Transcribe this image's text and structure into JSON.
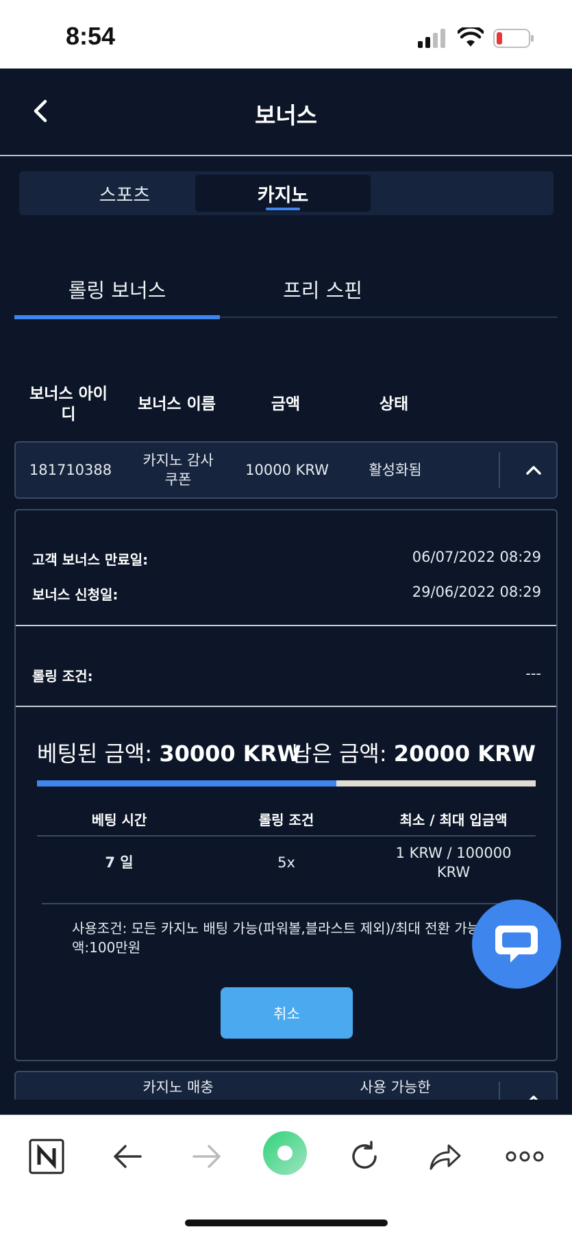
{
  "status_bar": {
    "time": "8:54"
  },
  "header": {
    "title": "보너스"
  },
  "segments": [
    {
      "label": "스포츠",
      "active": false
    },
    {
      "label": "카지노",
      "active": true
    }
  ],
  "subtabs": [
    {
      "label": "롤링 보너스",
      "active": true
    },
    {
      "label": "프리 스핀",
      "active": false
    }
  ],
  "table": {
    "headers": [
      "보너스 아이\n디",
      "보너스 이름",
      "금액",
      "상태"
    ],
    "rows": [
      {
        "id": "181710388",
        "name": "카지노 감사\n쿠폰",
        "amount": "10000 KRW",
        "status": "활성화됨"
      },
      {
        "id": "",
        "name": "카지노 매충",
        "amount": "",
        "status": "사용 가능한"
      }
    ]
  },
  "details": {
    "expiry_label": "고객 보너스 만료일:",
    "expiry_value": "06/07/2022 08:29",
    "applied_label": "보너스 신청일:",
    "applied_value": "29/06/2022 08:29",
    "rolling_label": "롤링 조건:",
    "rolling_value": "---",
    "bet_label": "베팅된 금액:",
    "bet_value": "30000 KRW",
    "remaining_label": "남은 금액:",
    "remaining_value": "20000 KRW",
    "progress_fraction": 0.6,
    "conditions_headers": [
      "베팅 시간",
      "롤링 조건",
      "최소 / 최대 입금액"
    ],
    "conditions_values": [
      "7 일",
      "5x",
      "1 KRW / 100000\nKRW"
    ],
    "usage_text": "사용조건: 모든 카지노 배팅 가능(파워볼,블라스트 제외)/최대 전환 가능금액:100만원",
    "cancel_label": "취소"
  },
  "colors": {
    "accent": "#3e86ee",
    "background": "#0c1628",
    "card": "#16253d",
    "cancel": "#4ba9f0"
  },
  "icons": {
    "back": "chevron-left-icon",
    "expand": "chevron-up-icon",
    "chat": "chat-bubble-icon",
    "browser": [
      "n-logo-icon",
      "arrow-left-icon",
      "arrow-right-icon",
      "record-icon",
      "reload-icon",
      "share-icon",
      "more-icon"
    ]
  }
}
